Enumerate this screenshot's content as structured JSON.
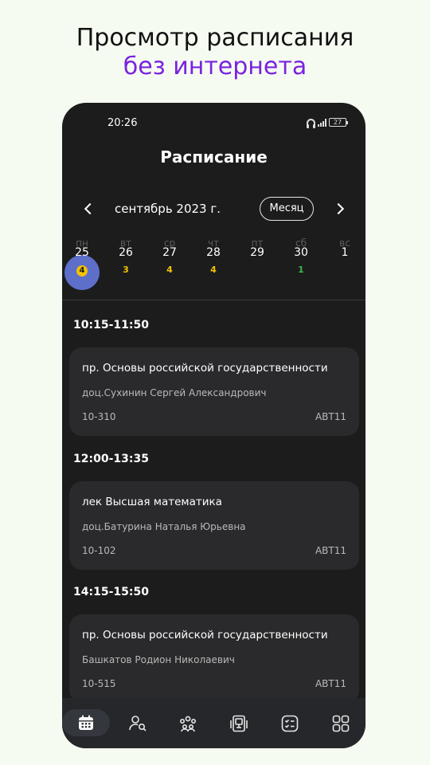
{
  "promo": {
    "line1": "Просмотр расписания",
    "line2": "без интернета"
  },
  "status_bar": {
    "time": "20:26",
    "battery": "27",
    "icons": [
      "headphones-icon",
      "signal-icon",
      "battery-icon"
    ]
  },
  "header": {
    "title": "Расписание"
  },
  "calendar": {
    "month_label": "сентябрь 2023 г.",
    "mode_button": "Месяц",
    "prev_icon": "chevron-left-icon",
    "next_icon": "chevron-right-icon",
    "days": [
      {
        "dow": "пн",
        "num": "25",
        "count": "4",
        "count_color": "#f2c200",
        "selected": true
      },
      {
        "dow": "вт",
        "num": "26",
        "count": "3",
        "count_color": "#f2c200",
        "selected": false
      },
      {
        "dow": "ср",
        "num": "27",
        "count": "4",
        "count_color": "#f2c200",
        "selected": false
      },
      {
        "dow": "чт",
        "num": "28",
        "count": "4",
        "count_color": "#f2c200",
        "selected": false
      },
      {
        "dow": "пт",
        "num": "29",
        "count": "",
        "count_color": "",
        "selected": false
      },
      {
        "dow": "сб",
        "num": "30",
        "count": "1",
        "count_color": "#3fb54a",
        "selected": false
      },
      {
        "dow": "вс",
        "num": "1",
        "count": "",
        "count_color": "",
        "selected": false
      }
    ]
  },
  "lessons": [
    {
      "time": "10:15-11:50",
      "subject": "пр. Основы российской государственности",
      "teacher": "доц.Сухинин Сергей Александрович",
      "room": "10-310",
      "group": "АВТ11"
    },
    {
      "time": "12:00-13:35",
      "subject": "лек Высшая математика",
      "teacher": "доц.Батурина Наталья Юрьевна",
      "room": "10-102",
      "group": "АВТ11"
    },
    {
      "time": "14:15-15:50",
      "subject": "пр. Основы российской государственности",
      "teacher": "Башкатов Родион Николаевич",
      "room": "10-515",
      "group": "АВТ11"
    }
  ],
  "bottom_nav": {
    "items": [
      {
        "icon": "calendar-icon",
        "active": true
      },
      {
        "icon": "teacher-search-icon",
        "active": false
      },
      {
        "icon": "groups-icon",
        "active": false
      },
      {
        "icon": "classroom-icon",
        "active": false
      },
      {
        "icon": "tasks-checklist-icon",
        "active": false
      },
      {
        "icon": "more-grid-icon",
        "active": false
      }
    ]
  },
  "colors": {
    "background": "#f5fbf1",
    "promo_accent": "#7a22e0",
    "phone_bg": "#1c1c1c",
    "card_bg": "#2a2a2c",
    "selected_day": "#5d6fc9",
    "count_yellow": "#f2c200",
    "count_green": "#3fb54a"
  }
}
